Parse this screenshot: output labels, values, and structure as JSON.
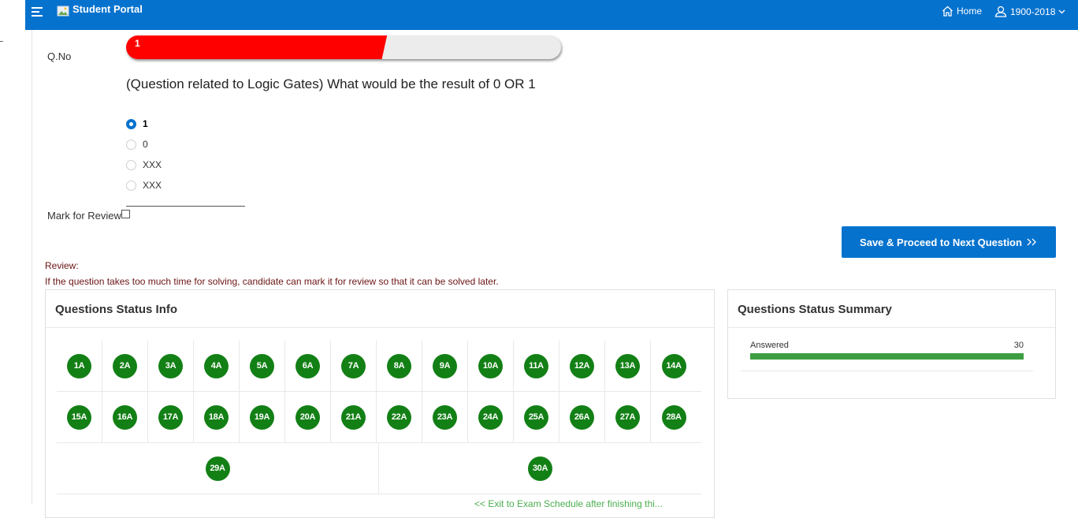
{
  "header": {
    "app_title": "Student Portal",
    "home_label": "Home",
    "user_label": "1900-2018",
    "bg_color": "#0572ce"
  },
  "question": {
    "qno_label": "Q.No",
    "number": "1",
    "progress_fraction": 0.6,
    "text": "(Question related to Logic Gates) What would be the result of 0 OR 1",
    "options": [
      {
        "label": "1",
        "selected": true
      },
      {
        "label": "0",
        "selected": false
      },
      {
        "label": "XXX",
        "selected": false
      },
      {
        "label": "XXX",
        "selected": false
      }
    ],
    "mark_for_review_label": "Mark for Review",
    "mark_for_review_checked": false
  },
  "actions": {
    "save_label": "Save & Proceed to Next Question",
    "save_icon": "double-chevron-right-icon"
  },
  "review": {
    "title": "Review:",
    "text": "If the question takes too much time for solving, candidate can mark it for review so that it can be solved later."
  },
  "status_info": {
    "title": "Questions Status Info",
    "rows": [
      [
        "1A",
        "2A",
        "3A",
        "4A",
        "5A",
        "6A",
        "7A",
        "8A",
        "9A",
        "10A",
        "11A",
        "12A",
        "13A",
        "14A"
      ],
      [
        "15A",
        "16A",
        "17A",
        "18A",
        "19A",
        "20A",
        "21A",
        "22A",
        "23A",
        "24A",
        "25A",
        "26A",
        "27A",
        "28A"
      ],
      [
        "29A",
        "30A"
      ]
    ],
    "badge_color": "#138016",
    "exit_text": "<< Exit to Exam Schedule after finishing thi..."
  },
  "status_summary": {
    "title": "Questions Status Summary",
    "items": [
      {
        "label": "Answered",
        "value": "30",
        "fraction": 1.0,
        "color": "#3d9e41"
      }
    ]
  }
}
